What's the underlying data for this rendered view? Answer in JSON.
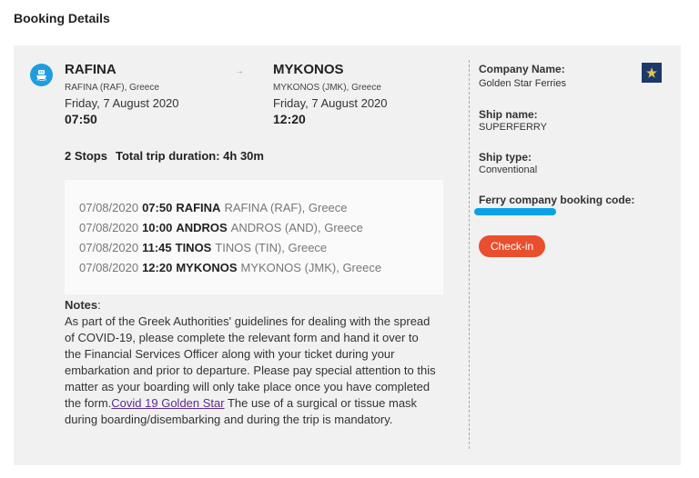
{
  "page_title": "Booking Details",
  "departure": {
    "city": "RAFINA",
    "port": "RAFINA (RAF), Greece",
    "date": "Friday, 7 August 2020",
    "time": "07:50"
  },
  "arrow": "→",
  "arrival": {
    "city": "MYKONOS",
    "port": "MYKONOS (JMK), Greece",
    "date": "Friday, 7 August 2020",
    "time": "12:20"
  },
  "summary": {
    "stops": "2 Stops",
    "duration": "Total trip duration: 4h 30m"
  },
  "stops": [
    {
      "date": "07/08/2020",
      "time": "07:50",
      "city": "RAFINA",
      "port": "RAFINA (RAF), Greece"
    },
    {
      "date": "07/08/2020",
      "time": "10:00",
      "city": "ANDROS",
      "port": "ANDROS (AND), Greece"
    },
    {
      "date": "07/08/2020",
      "time": "11:45",
      "city": "TINOS",
      "port": "TINOS (TIN), Greece"
    },
    {
      "date": "07/08/2020",
      "time": "12:20",
      "city": "MYKONOS",
      "port": "MYKONOS (JMK), Greece"
    }
  ],
  "notes": {
    "heading": "Notes",
    "colon": ":",
    "text_before_link": "As part of the Greek Authorities' guidelines for dealing with the spread of COVID-19, please complete the relevant form and hand it over to the Financial Services Officer along with your ticket during your embarkation and prior to departure. Please pay special attention to this matter as your boarding will only take place once you have completed the form.",
    "link_text": "Covid 19 Golden Star",
    "text_after_link": " The use of a surgical or tissue mask during boarding/disembarking and during the trip is mandatory."
  },
  "sidebar": {
    "company_label": "Company Name:",
    "company_value": "Golden Star Ferries",
    "ship_name_label": "Ship name:",
    "ship_name_value": "SUPERFERRY",
    "ship_type_label": "Ship type:",
    "ship_type_value": "Conventional",
    "booking_code_label": "Ferry company booking code:",
    "checkin_label": "Check-in"
  },
  "colors": {
    "accent_blue": "#1e9de0",
    "checkin_red": "#e94e2e",
    "link_purple": "#5b2d91",
    "card_bg": "#f1f1f1"
  },
  "icons": {
    "badge": "ship-icon",
    "company_logo": "golden-star-ferries-logo"
  }
}
